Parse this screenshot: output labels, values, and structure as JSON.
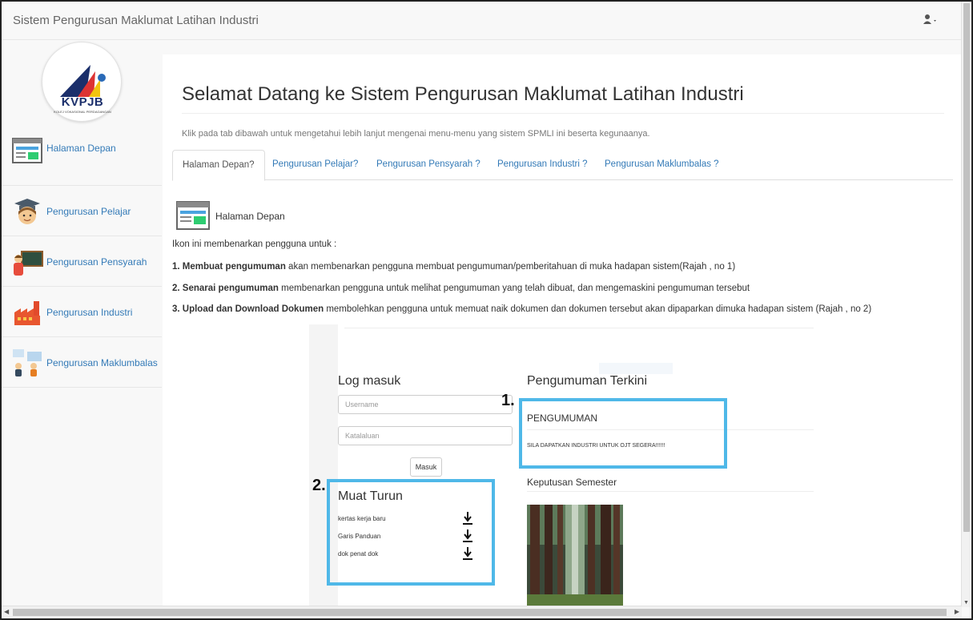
{
  "navbar": {
    "brand": "Sistem Pengurusan Maklumat Latihan Industri",
    "user_icon": "user-icon"
  },
  "logo": {
    "text": "KVPJB",
    "subtitle": "KOLEJ VOKASIONAL PERDAGANGAN"
  },
  "sidebar": {
    "items": [
      {
        "label": "Halaman Depan",
        "icon": "homepage-window-icon"
      },
      {
        "label": "Pengurusan Pelajar",
        "icon": "graduate-student-icon"
      },
      {
        "label": "Pengurusan Pensyarah",
        "icon": "lecturer-blackboard-icon"
      },
      {
        "label": "Pengurusan Industri",
        "icon": "factory-icon"
      },
      {
        "label": "Pengurusan Maklumbalas",
        "icon": "feedback-chat-icon"
      }
    ]
  },
  "main": {
    "title": "Selamat Datang ke Sistem Pengurusan Maklumat Latihan Industri",
    "intro": "Klik pada tab dibawah untuk mengetahui lebih lanjut mengenai menu-menu yang sistem SPMLI ini beserta kegunaanya.",
    "tabs": [
      {
        "label": "Halaman Depan?",
        "active": true
      },
      {
        "label": "Pengurusan Pelajar?",
        "active": false
      },
      {
        "label": "Pengurusan Pensyarah ?",
        "active": false
      },
      {
        "label": "Pengurusan Industri ?",
        "active": false
      },
      {
        "label": "Pengurusan Maklumbalas ?",
        "active": false
      }
    ],
    "section_title": "Halaman Depan",
    "description": "Ikon ini membenarkan pengguna untuk :",
    "points": [
      {
        "bold": "1. Membuat pengumuman",
        "text": " akan membenarkan pengguna membuat pengumuman/pemberitahuan di muka hadapan sistem(Rajah , no 1)"
      },
      {
        "bold": "2. Senarai pengumuman",
        "text": " membenarkan pengguna untuk melihat pengumuman yang telah dibuat, dan mengemaskini pengumuman tersebut"
      },
      {
        "bold": "3. Upload dan Download Dokumen",
        "text": " membolehkan pengguna untuk memuat naik dokumen dan dokumen tersebut akan dipaparkan dimuka hadapan sistem (Rajah , no 2)"
      }
    ]
  },
  "figure": {
    "login_title": "Log masuk",
    "username_placeholder": "Username",
    "password_placeholder": "Katalaluan",
    "login_button": "Masuk",
    "announcement_title": "Pengumuman Terkini",
    "announcement_heading": "PENGUMUMAN",
    "announcement_text": "SILA DAPATKAN INDUSTRI UNTUK OJT SEGERA!!!!!!",
    "semester_title": "Keputusan Semester",
    "download_title": "Muat Turun",
    "downloads": [
      "kertas kerja baru",
      "Garis Panduan",
      "dok penat dok"
    ],
    "callout_1": "1.",
    "callout_2": "2.",
    "highlight_color": "#4fb8e8"
  }
}
